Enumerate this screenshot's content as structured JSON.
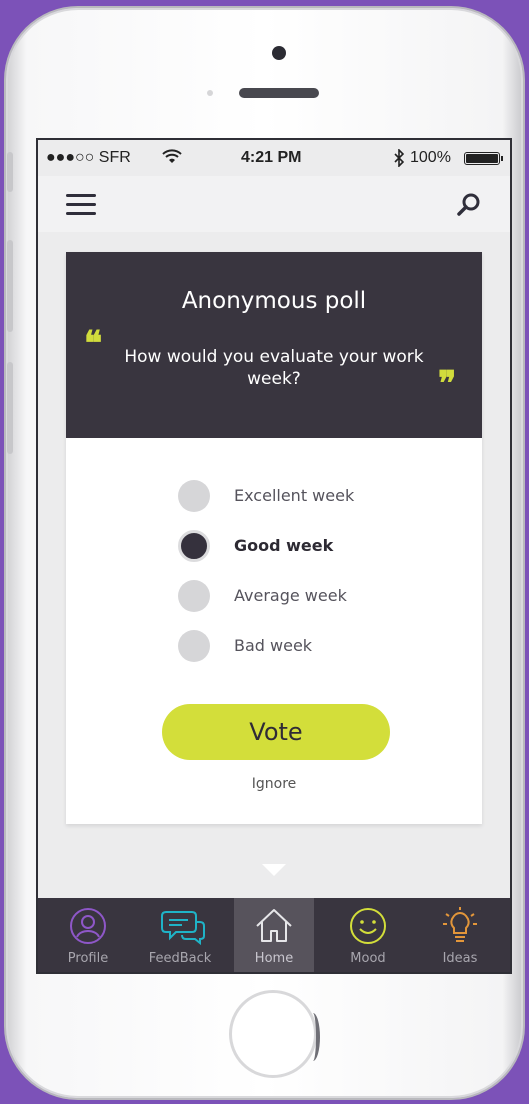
{
  "status_bar": {
    "carrier": "●●●○○ SFR",
    "wifi_icon": "wifi-icon",
    "time": "4:21 PM",
    "bluetooth_icon": "bluetooth-icon",
    "battery": "100%",
    "battery_level_percent": 100
  },
  "app_bar": {
    "menu_icon": "hamburger-menu-icon",
    "search_icon": "search-icon"
  },
  "poll": {
    "title": "Anonymous poll",
    "question": "How would you evaluate your work week?",
    "quote_open": "❝",
    "quote_close": "❞",
    "options": [
      {
        "label": "Excellent week",
        "selected": false
      },
      {
        "label": "Good week",
        "selected": true
      },
      {
        "label": "Average week",
        "selected": false
      },
      {
        "label": "Bad week",
        "selected": false
      }
    ],
    "vote_label": "Vote",
    "ignore_label": "Ignore"
  },
  "tabbar": {
    "tabs": [
      {
        "label": "Profile",
        "icon": "profile-icon",
        "color": "#8e57c8",
        "active": false
      },
      {
        "label": "FeedBack",
        "icon": "feedback-icon",
        "color": "#1fb3c7",
        "active": false
      },
      {
        "label": "Home",
        "icon": "home-icon",
        "color": "#e6e6e9",
        "active": true
      },
      {
        "label": "Mood",
        "icon": "mood-icon",
        "color": "#d3de3a",
        "active": false
      },
      {
        "label": "Ideas",
        "icon": "idea-icon",
        "color": "#e3963a",
        "active": false
      }
    ]
  },
  "colors": {
    "accent": "#d3de3a",
    "header_dark": "#39353f",
    "background": "#7c52b8"
  }
}
